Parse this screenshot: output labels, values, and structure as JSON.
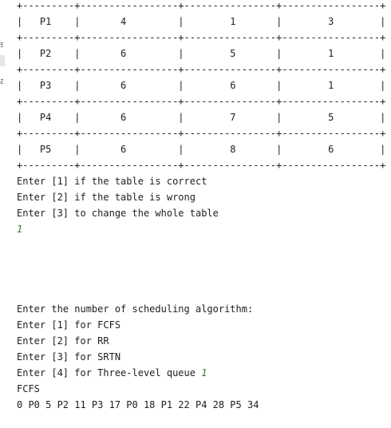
{
  "table": {
    "border": "+---------+-----------------+----------------+-----------------+",
    "rows": [
      "|   P1    |       4         |        1       |        3        |",
      "|   P2    |       6         |        5       |        1        |",
      "|   P3    |       6         |        6       |        1        |",
      "|   P4    |       6         |        7       |        5        |",
      "|   P5    |       6         |        8       |        6        |"
    ]
  },
  "prompts": {
    "confirm_line_1": "Enter [1] if the table is correct",
    "confirm_line_2": "Enter [2] if the table is wrong",
    "confirm_line_3": "Enter [3] to change the whole table",
    "confirm_input": "1",
    "algo_title": "Enter the number of scheduling algorithm:",
    "algo_option_1": "Enter [1] for FCFS",
    "algo_option_2": "Enter [2] for RR",
    "algo_option_3": "Enter [3] for SRTN",
    "algo_option_4": "Enter [4] for Three-level queue ",
    "algo_input": "1"
  },
  "result": {
    "algorithm": "FCFS",
    "timeline": "0 P0 5 P2 11 P3 17 P0 18 P1 22 P4 28 P5 34"
  },
  "colors": {
    "text": "#1e1e1e",
    "user_input": "#2e7d32",
    "background": "#ffffff"
  }
}
